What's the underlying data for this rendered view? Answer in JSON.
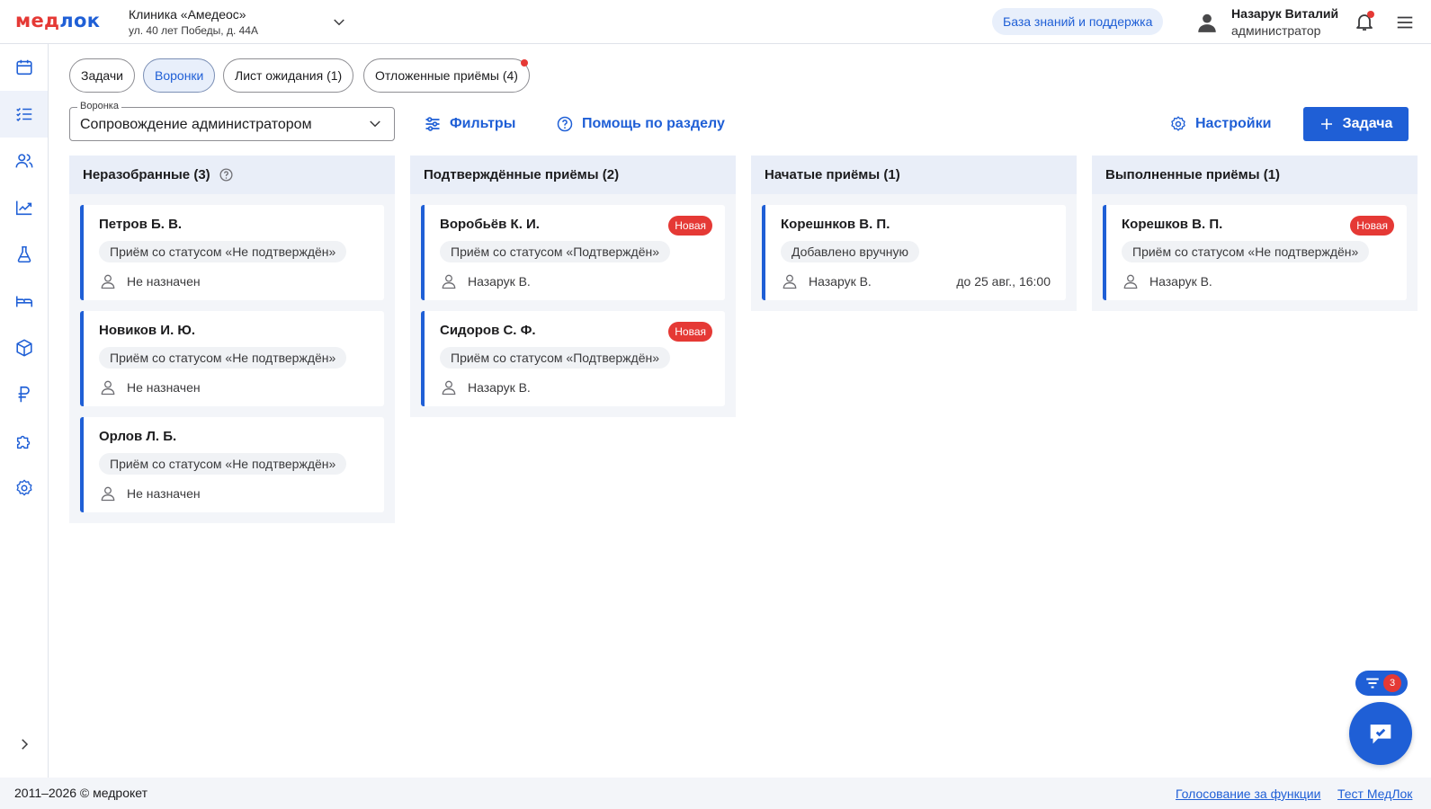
{
  "header": {
    "logo": "медлок",
    "clinic_name": "Клиника «Амедеос»",
    "clinic_address": "ул. 40 лет Победы, д. 44А",
    "kb_label": "База знаний и поддержка",
    "user_name": "Назарук Виталий",
    "user_role": "администратор"
  },
  "sidebar": {
    "items": [
      {
        "icon": "calendar-icon"
      },
      {
        "icon": "task-list-icon",
        "active": true
      },
      {
        "icon": "users-icon"
      },
      {
        "icon": "chart-icon"
      },
      {
        "icon": "flask-icon"
      },
      {
        "icon": "bed-icon"
      },
      {
        "icon": "box-icon"
      },
      {
        "icon": "ruble-icon"
      },
      {
        "icon": "puzzle-icon"
      },
      {
        "icon": "gear-icon"
      }
    ],
    "expand_icon": "chevron-right-icon"
  },
  "tabs": [
    {
      "label": "Задачи",
      "active": false
    },
    {
      "label": "Воронки",
      "active": true
    },
    {
      "label": "Лист ожидания (1)",
      "active": false
    },
    {
      "label": "Отложенные приёмы (4)",
      "active": false
    }
  ],
  "toolbar": {
    "funnel_label": "Воронка",
    "funnel_value": "Сопровождение администратором",
    "filters_label": "Фильтры",
    "help_label": "Помощь по разделу",
    "settings_label": "Настройки",
    "add_label": "Задача"
  },
  "columns": [
    {
      "title": "Неразобранные (3)",
      "cards": [
        {
          "name": "Петров Б. В.",
          "status": "Приём со статусом «Не подтверждён»",
          "assignee": "Не назначен"
        },
        {
          "name": "Новиков И. Ю.",
          "status": "Приём со статусом «Не подтверждён»",
          "assignee": "Не назначен"
        },
        {
          "name": "Орлов Л. Б.",
          "status": "Приём со статусом «Не подтверждён»",
          "assignee": "Не назначен"
        }
      ]
    },
    {
      "title": "Подтверждённые приёмы (2)",
      "cards": [
        {
          "name": "Воробьёв К. И.",
          "badge": "Новая",
          "status": "Приём со статусом «Подтверждён»",
          "assignee": "Назарук В."
        },
        {
          "name": "Сидоров С. Ф.",
          "badge": "Новая",
          "status": "Приём со статусом «Подтверждён»",
          "assignee": "Назарук В."
        }
      ]
    },
    {
      "title": "Начатые приёмы (1)",
      "cards": [
        {
          "name": "Корешнков В. П.",
          "status": "Добавлено вручную",
          "assignee": "Назарук В.",
          "due": "до 25 авг., 16:00"
        }
      ]
    },
    {
      "title": "Выполненные приёмы (1)",
      "cards": [
        {
          "name": "Корешков В. П.",
          "badge": "Новая",
          "status": "Приём со статусом «Не подтверждён»",
          "assignee": "Назарук В."
        }
      ]
    }
  ],
  "floating": {
    "filter_count": "3"
  },
  "footer": {
    "copyright": "2011–2026 © медрокет",
    "links": [
      "Голосование за функции",
      "Тест МедЛок"
    ]
  },
  "colors": {
    "accent": "#1f5fd6",
    "danger": "#e53935",
    "column_bg": "#f3f5f9",
    "column_head_bg": "#e9eef8"
  }
}
